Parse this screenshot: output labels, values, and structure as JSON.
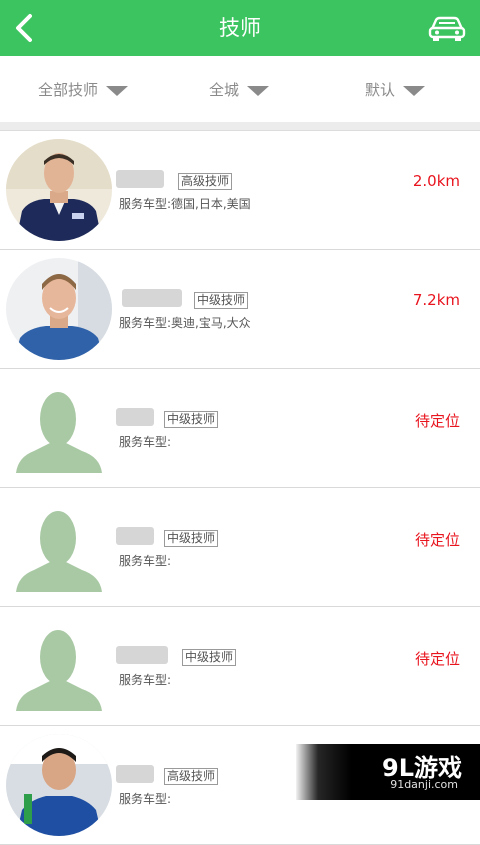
{
  "header": {
    "title": "技师"
  },
  "filters": [
    {
      "label": "全部技师"
    },
    {
      "label": "全城"
    },
    {
      "label": "默认"
    }
  ],
  "technicians": [
    {
      "level": "高级技师",
      "vehicles": "服务车型:德国,日本,美国",
      "distance": "2.0km",
      "avatar": "photo"
    },
    {
      "level": "中级技师",
      "vehicles": "服务车型:奥迪,宝马,大众",
      "distance": "7.2km",
      "avatar": "photo"
    },
    {
      "level": "中级技师",
      "vehicles": "服务车型:",
      "distance": "待定位",
      "avatar": "placeholder"
    },
    {
      "level": "中级技师",
      "vehicles": "服务车型:",
      "distance": "待定位",
      "avatar": "placeholder"
    },
    {
      "level": "中级技师",
      "vehicles": "服务车型:",
      "distance": "待定位",
      "avatar": "placeholder"
    },
    {
      "level": "高级技师",
      "vehicles": "服务车型:",
      "distance": "",
      "avatar": "photo"
    }
  ],
  "watermark": {
    "brand": "9L游戏",
    "site": "91danji.com"
  },
  "colors": {
    "header": "#3cc460",
    "distance": "#e8141e",
    "placeholder_avatar": "#a9c9a4"
  }
}
